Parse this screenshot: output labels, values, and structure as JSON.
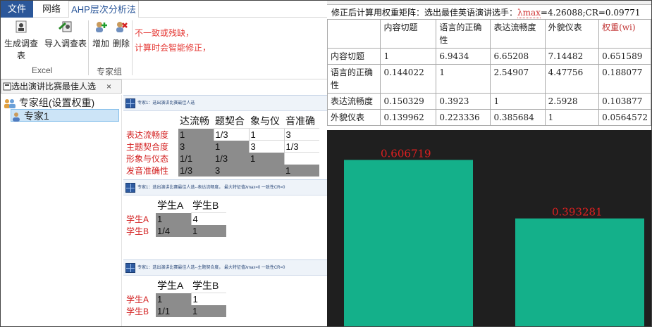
{
  "menubar": {
    "file": "文件",
    "network": "网络",
    "ahp": "AHP层次分析法"
  },
  "ribbon": {
    "generate": "生成调查表",
    "import": "导入调查表",
    "add": "增加",
    "delete": "删除",
    "group_excel": "Excel",
    "group_expert": "专家组",
    "warning_line1": "不一致或残缺，",
    "warning_line2": "计算时会智能修正，"
  },
  "doc_tab": {
    "label": "选出演讲比赛最佳人选",
    "close": "×"
  },
  "tree": {
    "root": "专家组(设置权重)",
    "child": "专家1"
  },
  "panel1": {
    "head": "专家1：选出演讲比赛最佳人选",
    "columns": [
      "达流畅",
      "题契合",
      "象与仪",
      "音准确"
    ],
    "rows": [
      {
        "label": "表达流畅度",
        "cells": [
          "1",
          "1/3",
          "1",
          "3"
        ]
      },
      {
        "label": "主题契合度",
        "cells": [
          "3",
          "1",
          "3",
          "1/3"
        ]
      },
      {
        "label": "形象与仪态",
        "cells": [
          "1/1",
          "1/3",
          "1",
          ""
        ]
      },
      {
        "label": "发音准确性",
        "cells": [
          "1/3",
          "3",
          "",
          "1"
        ]
      }
    ]
  },
  "panel2": {
    "head": "专家1：选出演讲比赛最佳人选--表达流畅度，  最大特征值λmax=0  一致性CR=0",
    "columns": [
      "学生A",
      "学生B"
    ],
    "rows": [
      {
        "label": "学生A",
        "cells": [
          "1",
          "4"
        ]
      },
      {
        "label": "学生B",
        "cells": [
          "1/4",
          "1"
        ]
      }
    ]
  },
  "panel3": {
    "head": "专家1：选出演讲比赛最佳人选--主题契合度，  最大特征值λmax=0  一致性CR=0",
    "columns": [
      "学生A",
      "学生B"
    ],
    "rows": [
      {
        "label": "学生A",
        "cells": [
          "1",
          "1"
        ]
      },
      {
        "label": "学生B",
        "cells": [
          "1/1",
          "1"
        ]
      }
    ]
  },
  "right": {
    "caption_prefix": "修正后计算用权重矩阵：选出最佳英语演讲选手：",
    "caption_lambda": "λmax",
    "caption_rest": "=4.26088;CR=0.09771",
    "table": {
      "headers": [
        "",
        "内容切题",
        "语言的正确性",
        "表达流畅度",
        "外貌仪表",
        "权重(wi)"
      ],
      "rows": [
        [
          "内容切题",
          "1",
          "6.9434",
          "6.65208",
          "7.14482",
          "0.651589"
        ],
        [
          "语言的正确性",
          "0.144022",
          "1",
          "2.54907",
          "4.47756",
          "0.188077"
        ],
        [
          "表达流畅度",
          "0.150329",
          "0.3923",
          "1",
          "2.5928",
          "0.103877"
        ],
        [
          "外貌仪表",
          "0.139962",
          "0.223336",
          "0.385684",
          "1",
          "0.0564572"
        ]
      ]
    }
  },
  "chart_data": {
    "type": "bar",
    "values": [
      0.606719,
      0.393281
    ],
    "data_labels": [
      "0.606719",
      "0.393281"
    ],
    "bar_color": "#14b08a",
    "label_color": "#e02020",
    "background": "#1f1f1f",
    "ylim": [
      0,
      0.7
    ]
  }
}
